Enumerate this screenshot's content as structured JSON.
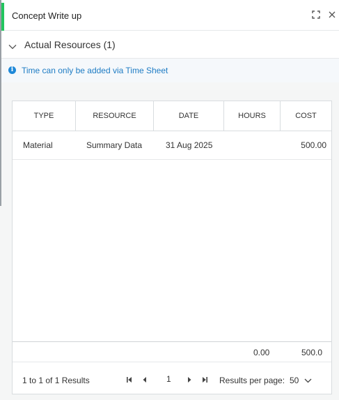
{
  "header": {
    "title": "Concept Write up",
    "accent_color": "#22c55e",
    "icons": [
      "expand-icon",
      "close-icon"
    ]
  },
  "section": {
    "label": "Actual Resources (1)"
  },
  "info": {
    "message": "Time can only be added via Time Sheet",
    "color": "#1e7cc4"
  },
  "table": {
    "columns": [
      "TYPE",
      "RESOURCE",
      "DATE",
      "HOURS",
      "COST"
    ],
    "rows": [
      {
        "type": "Material",
        "resource": "Summary Data",
        "date": "31 Aug 2025",
        "hours": "",
        "cost": "500.00"
      }
    ],
    "totals": {
      "hours": "0.00",
      "cost": "500.0"
    }
  },
  "pager": {
    "summary": "1 to 1 of 1 Results",
    "current_page": "1",
    "results_per_page_label": "Results per page:",
    "results_per_page_value": "50"
  }
}
